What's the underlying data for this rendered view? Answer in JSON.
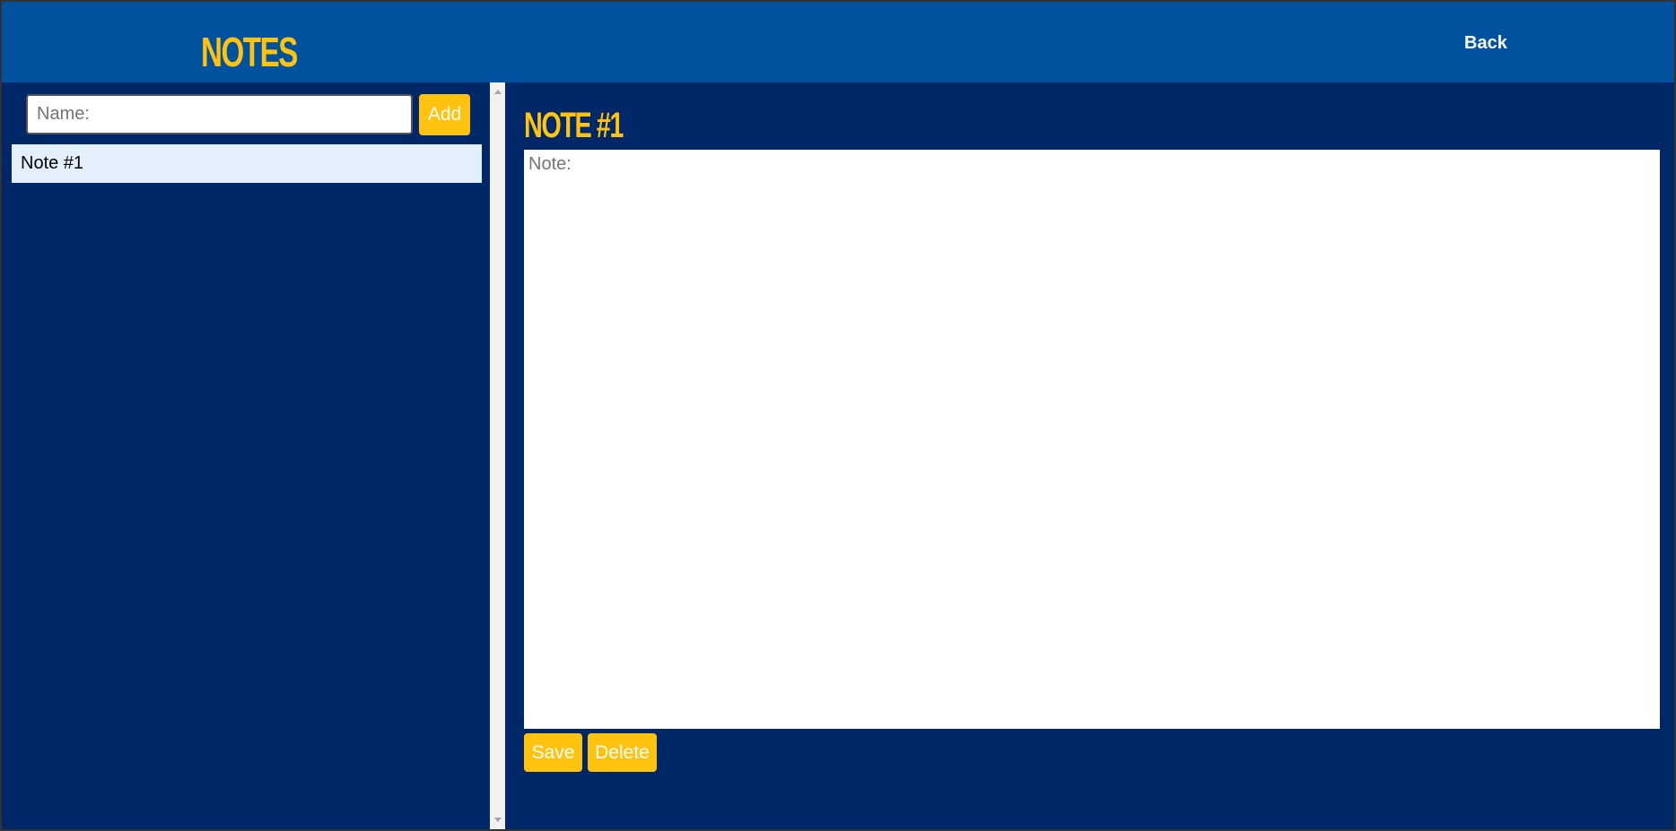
{
  "header": {
    "title": "NOTES",
    "back_label": "Back"
  },
  "sidebar": {
    "name_input": {
      "placeholder": "Name:",
      "value": ""
    },
    "add_label": "Add",
    "notes": [
      {
        "label": "Note #1",
        "selected": true
      }
    ]
  },
  "editor": {
    "title": "NOTE #1",
    "note_placeholder": "Note:",
    "note_value": "",
    "save_label": "Save",
    "delete_label": "Delete"
  },
  "colors": {
    "header_bg": "#00529f",
    "page_bg": "#002868",
    "accent": "#ffc20e",
    "selected_item_bg": "#e3f0fb"
  }
}
